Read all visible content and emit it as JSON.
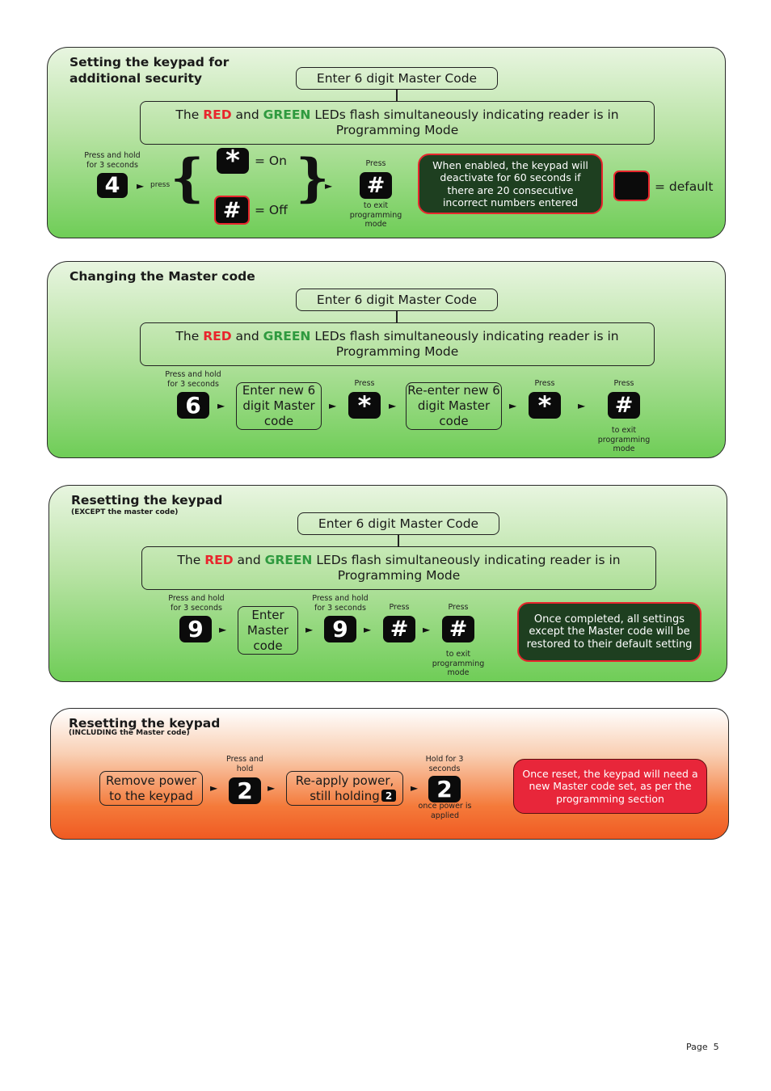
{
  "common": {
    "enter_master": "Enter 6 digit Master Code",
    "prog_the": "The ",
    "prog_red": "RED",
    "prog_and": " and ",
    "prog_green": "GREEN",
    "prog_rest": " LEDs flash simultaneously indicating reader is in",
    "prog_line2": "Programming Mode",
    "press_hold_3": "Press and hold for 3 seconds",
    "press": "Press",
    "to_exit": "to exit programming mode",
    "arrow": "►"
  },
  "section1": {
    "title_line1": "Setting the keypad for",
    "title_line2": "additional security",
    "key_start": "4",
    "press_label": "press",
    "key_on": "*",
    "on_label": "= On",
    "key_off": "#",
    "off_label": "= Off",
    "key_exit": "#",
    "note": "When enabled, the keypad will deactivate for 60 seconds if there are 20 consecutive incorrect numbers entered",
    "default_label": "= default"
  },
  "section2": {
    "title": "Changing the Master code",
    "key_start": "6",
    "step1": "Enter new 6 digit Master code",
    "key_confirm1": "*",
    "step2": "Re-enter new 6 digit Master code",
    "key_confirm2": "*",
    "key_exit": "#"
  },
  "section3": {
    "title": "Resetting the keypad",
    "subtitle": "(EXCEPT the master code)",
    "key_start": "9",
    "step1": "Enter Master code",
    "key_second": "9",
    "key_hash1": "#",
    "key_hash2": "#",
    "note": "Once completed, all settings except the Master code will be restored to their default setting"
  },
  "section4": {
    "title": "Resetting the keypad",
    "subtitle": "(INCLUDING the Master code)",
    "step1": "Remove power to the keypad",
    "press_and_hold": "Press and hold",
    "key_first": "2",
    "step2": "Re-apply power, still holding",
    "key_inline": "2",
    "hold_3": "Hold for 3 seconds",
    "key_second": "2",
    "once_power": "once power is applied",
    "note": "Once reset, the keypad will need a new Master code set, as per the programming section"
  },
  "footer": {
    "page_label": "Page",
    "page_number": "5"
  }
}
